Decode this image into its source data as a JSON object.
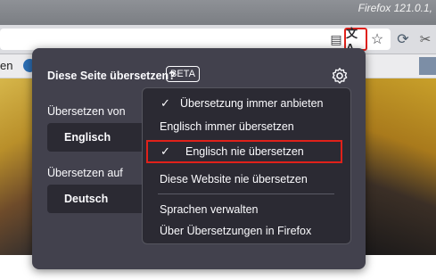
{
  "window": {
    "title": "Firefox 121.0.1,"
  },
  "toolbar": {
    "reader_icon": "▤",
    "translate_icon": "文A",
    "star_icon": "☆",
    "reload_icon": "⟳",
    "extension_icon": "✂"
  },
  "bookmarks": {
    "first_item": "en"
  },
  "panel": {
    "title": "Diese Seite übersetzen?",
    "badge": "BETA",
    "from_label": "Übersetzen von",
    "from_value": "Englisch",
    "to_label": "Übersetzen auf",
    "to_value": "Deutsch"
  },
  "menu": {
    "items": [
      {
        "label": "Übersetzung immer anbieten",
        "checked": true
      },
      {
        "label": "Englisch immer übersetzen",
        "checked": false
      },
      {
        "label": "Englisch nie übersetzen",
        "checked": true
      },
      {
        "label": "Diese Website nie übersetzen",
        "checked": false
      },
      {
        "label": "Sprachen verwalten",
        "checked": false
      },
      {
        "label": "Über Übersetzungen in Firefox",
        "checked": false
      }
    ],
    "check_glyph": "✓"
  },
  "colors": {
    "panel_bg": "#42414d",
    "menu_bg": "#2b2a33",
    "highlight": "#e0211a",
    "text": "#fbfbfe"
  }
}
